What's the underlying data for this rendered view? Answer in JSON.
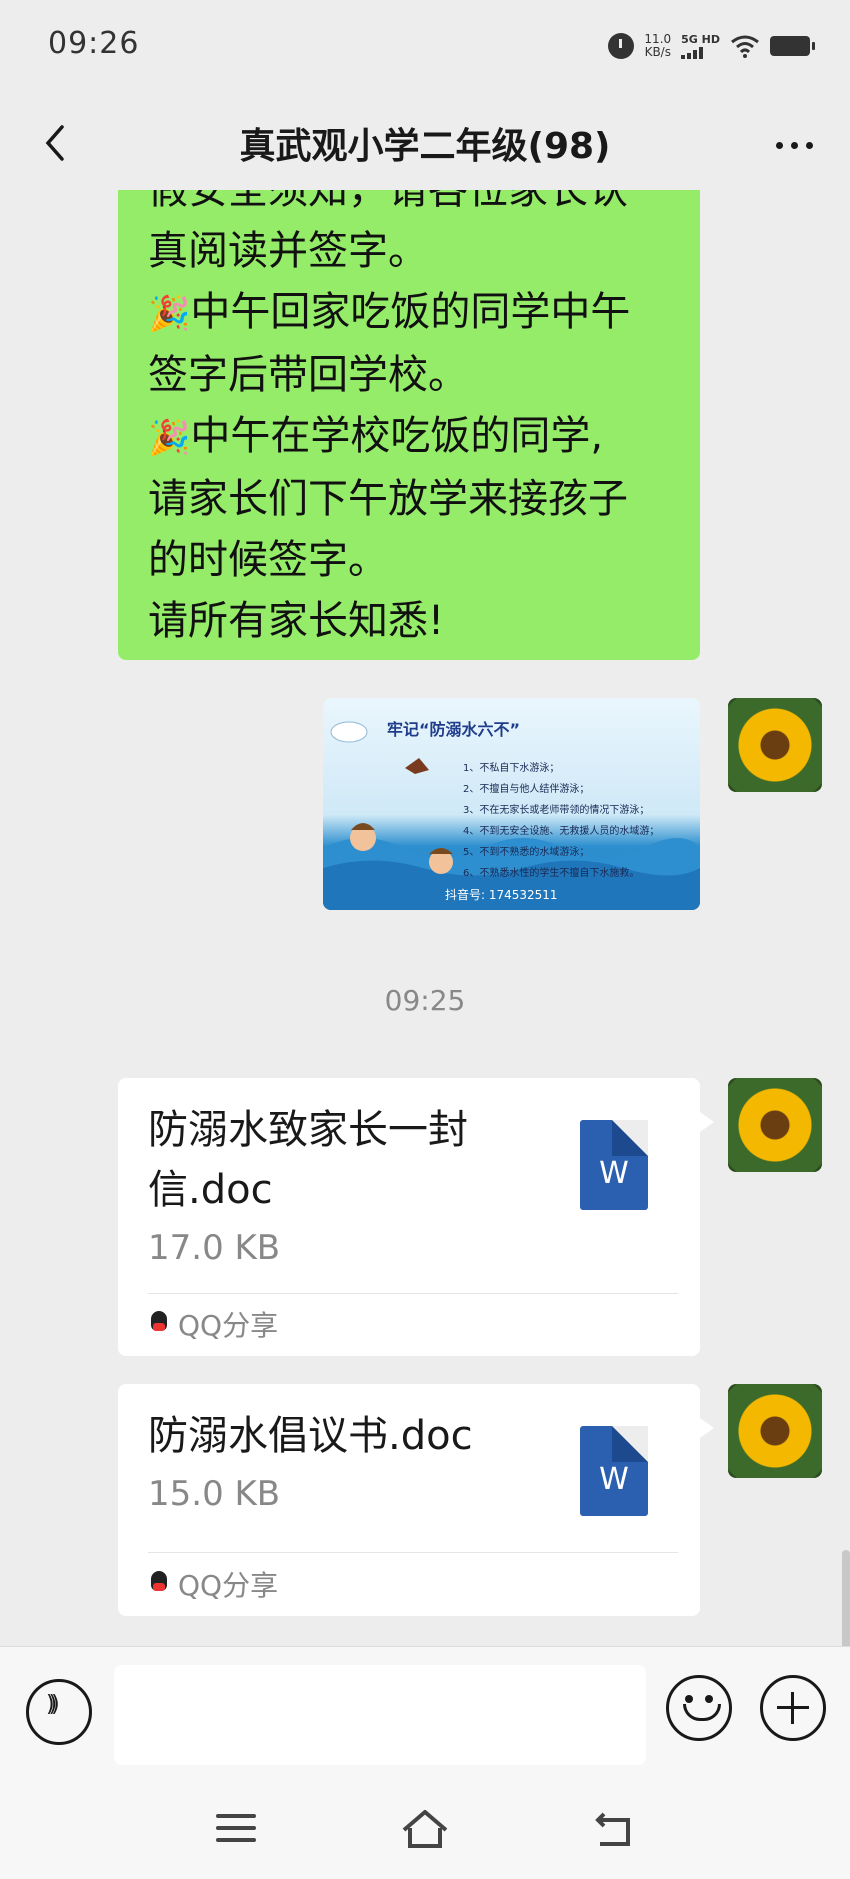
{
  "status_bar": {
    "time": "09:26",
    "speed_value": "11.0",
    "speed_unit": "KB/s",
    "network": "5G HD",
    "icons": [
      "alarm-icon",
      "signal-icon",
      "wifi-icon",
      "battery-icon"
    ]
  },
  "header": {
    "title": "真武观小学二年级(98)",
    "back_icon": "chevron-left-icon",
    "more_icon": "more-dots-icon"
  },
  "messages": {
    "text_message": {
      "lines": [
        {
          "emoji": "",
          "text": "假安全须知，请各位家长认"
        },
        {
          "emoji": "",
          "text": "真阅读并签字。"
        },
        {
          "emoji": "🎉",
          "text": "中午回家吃饭的同学中午"
        },
        {
          "emoji": "",
          "text": "签字后带回学校。"
        },
        {
          "emoji": "🎉",
          "text": "中午在学校吃饭的同学,"
        },
        {
          "emoji": "",
          "text": "请家长们下午放学来接孩子"
        },
        {
          "emoji": "",
          "text": "的时候签字。"
        },
        {
          "emoji": "",
          "text": "请所有家长知悉!"
        }
      ]
    },
    "image_message": {
      "title": "牢记“防溺水六不”",
      "lines": [
        "1、不私自下水游泳；",
        "2、不擅自与他人结伴游泳；",
        "3、不在无家长或老师带领的情况下游泳；",
        "4、不到无安全设施、无救援人员的水域游；",
        "5、不到不熟悉的水域游泳；",
        "6、不熟悉水性的学生不擅自下水施救。"
      ],
      "footer": "抖音号: 174532511"
    },
    "timestamp": "09:25",
    "files": [
      {
        "name": "防溺水致家长一封信.doc",
        "size": "17.0 KB",
        "source": "QQ分享",
        "icon_letter": "W"
      },
      {
        "name": "防溺水倡议书.doc",
        "size": "15.0 KB",
        "source": "QQ分享",
        "icon_letter": "W"
      }
    ]
  },
  "input_bar": {
    "value": "",
    "voice_icon": "voice-icon",
    "emoji_icon": "emoji-icon",
    "plus_icon": "plus-icon"
  },
  "nav_bar": {
    "icons": [
      "menu-icon",
      "home-icon",
      "back-icon"
    ]
  },
  "colors": {
    "background": "#ededed",
    "sent_bubble": "#95ec69",
    "card": "#ffffff",
    "word_blue": "#2b5faf"
  }
}
